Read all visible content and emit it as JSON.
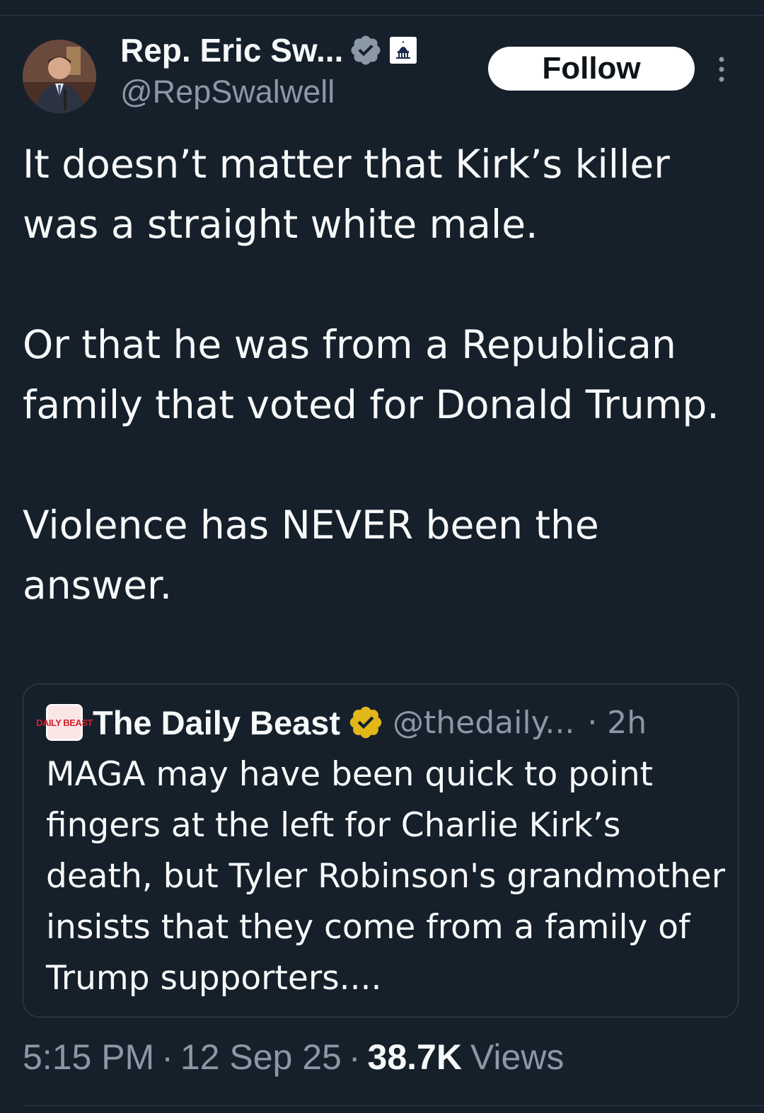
{
  "tweet": {
    "author": {
      "display_name": "Rep. Eric Sw...",
      "handle": "@RepSwalwell",
      "verified_icon": "verified-badge-blue",
      "affiliation_icon": "government-capitol-icon"
    },
    "follow_label": "Follow",
    "more_icon": "more-vertical-icon",
    "paragraphs": [
      "It doesn’t matter that Kirk’s killer was a straight white male.",
      "Or that he was from a Republican family that voted for Donald Trump.",
      "Violence has NEVER been the answer."
    ],
    "quoted": {
      "avatar_text": "DAILY BEAST",
      "display_name": "The Daily Beast",
      "verified_icon": "verified-badge-gold",
      "handle": "@thedaily...",
      "time": "· 2h",
      "text": "MAGA may have been quick to point fingers at the left for Charlie Kirk’s death, but Tyler Robinson's grandmother insists that they come from a family of Trump supporters...."
    },
    "meta": {
      "time": "5:15 PM",
      "separator": "·",
      "date": "12 Sep 25",
      "views_count": "38.7K",
      "views_label": "Views"
    }
  },
  "colors": {
    "background": "#15202b",
    "text_primary": "#f7f9f9",
    "text_secondary": "#8b98a5",
    "border": "#38444d",
    "verified_blue": "#1d9bf0",
    "verified_gold": "#e2b719",
    "daily_beast_red": "#d0222c"
  }
}
